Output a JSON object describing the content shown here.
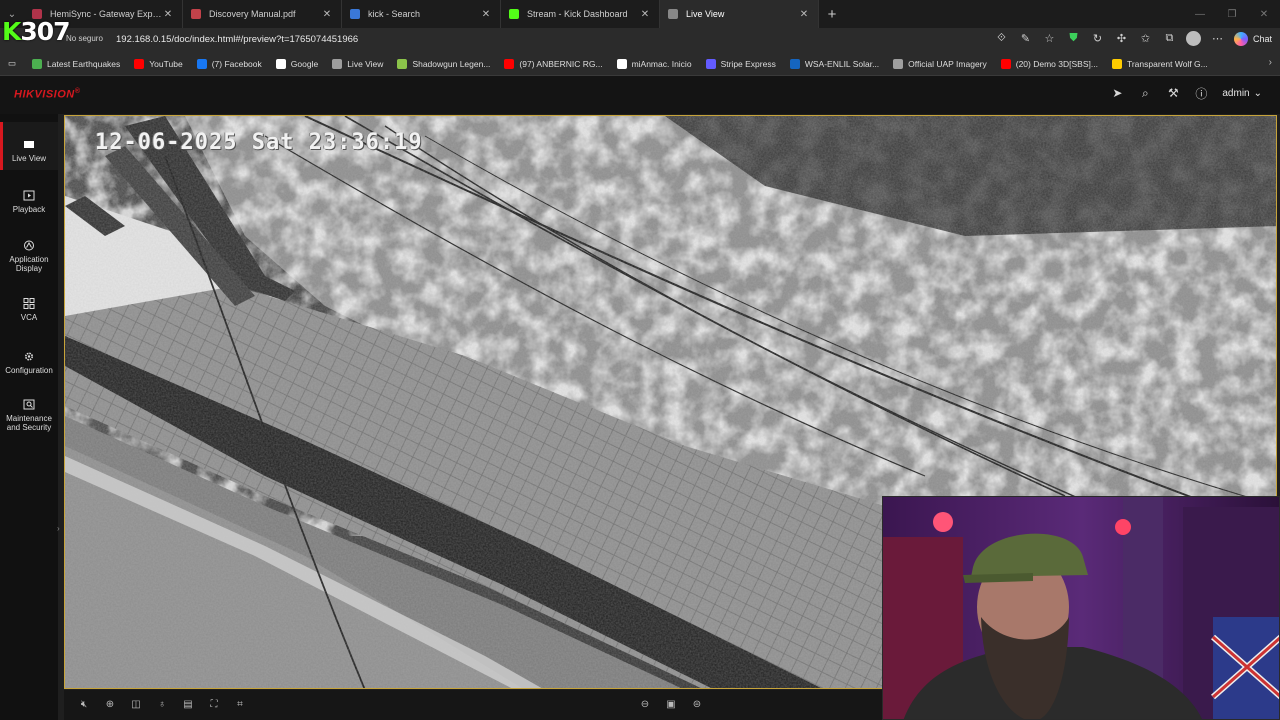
{
  "browser": {
    "tabs": [
      {
        "title": "HemiSync - Gateway Experience -",
        "color": "#b0334a",
        "active": false
      },
      {
        "title": "Discovery Manual.pdf",
        "color": "#c2424a",
        "active": false
      },
      {
        "title": "kick - Search",
        "color": "#3a78d8",
        "active": false
      },
      {
        "title": "Stream - Kick Dashboard",
        "color": "#53fc18",
        "active": false
      },
      {
        "title": "Live View",
        "color": "#888888",
        "active": true
      }
    ],
    "new_tab": "+",
    "overlay_badge_k": "K",
    "overlay_badge_num": "307",
    "security_label": "No seguro",
    "url": "192.168.0.15/doc/index.html#/preview?t=1765074451966",
    "chat_label": "Chat",
    "bookmarks": [
      {
        "label": "Latest Earthquakes",
        "color": "#4caf50"
      },
      {
        "label": "YouTube",
        "color": "#ff0000"
      },
      {
        "label": "(7) Facebook",
        "color": "#1877f2"
      },
      {
        "label": "Google",
        "color": "#ffffff"
      },
      {
        "label": "Live View",
        "color": "#9e9e9e"
      },
      {
        "label": "Shadowgun Legen...",
        "color": "#8bc34a"
      },
      {
        "label": "(97) ANBERNIC RG...",
        "color": "#ff0000"
      },
      {
        "label": "miAnmac. Inicio",
        "color": "#ffffff"
      },
      {
        "label": "Stripe Express",
        "color": "#635bff"
      },
      {
        "label": "WSA-ENLIL Solar...",
        "color": "#1565c0"
      },
      {
        "label": "Official UAP Imagery",
        "color": "#9e9e9e"
      },
      {
        "label": "(20) Demo 3D[SBS]...",
        "color": "#ff0000"
      },
      {
        "label": "Transparent Wolf G...",
        "color": "#ffcc00"
      }
    ]
  },
  "app": {
    "logo": "HIKVISION",
    "logo_mark": "®",
    "user": "admin",
    "accent": "#d7181f",
    "nav": [
      {
        "label": "Live View",
        "icon": "live-view-icon",
        "active": true
      },
      {
        "label": "Playback",
        "icon": "playback-icon",
        "active": false
      },
      {
        "label": "Application Display",
        "icon": "application-display-icon",
        "active": false
      },
      {
        "label": "VCA",
        "icon": "vca-icon",
        "active": false
      },
      {
        "label": "Configuration",
        "icon": "gear-icon",
        "active": false
      },
      {
        "label": "Maintenance and Security",
        "icon": "maintenance-icon",
        "active": false
      }
    ]
  },
  "video": {
    "osd_timestamp": "12-06-2025 Sat 23:36:19"
  }
}
